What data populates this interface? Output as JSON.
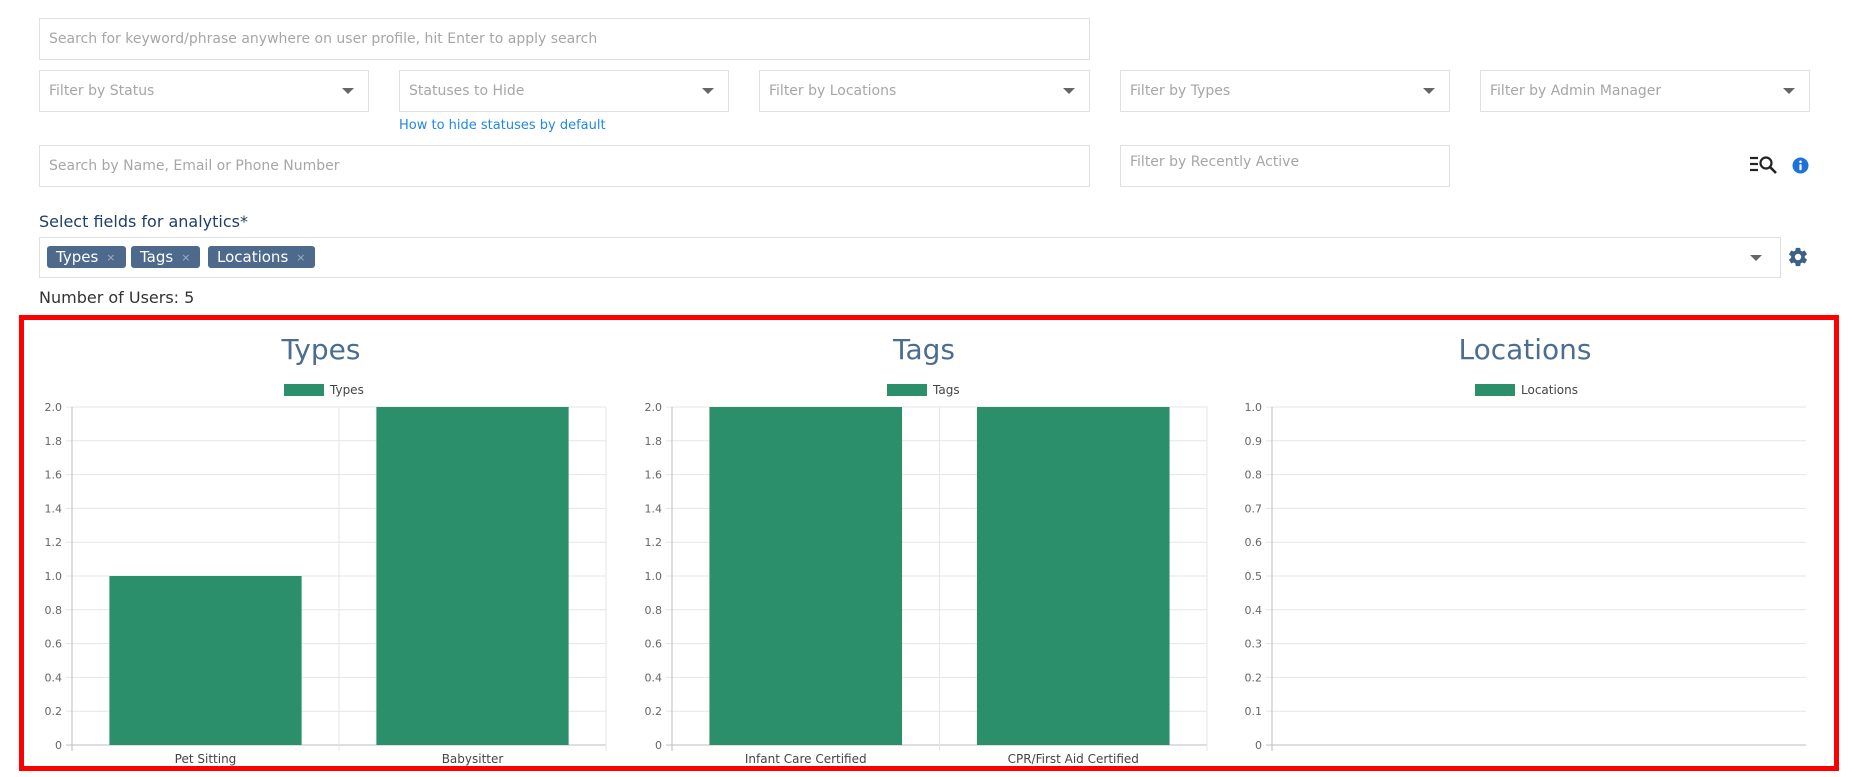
{
  "filters": {
    "keyword_search_placeholder": "Search for keyword/phrase anywhere on user profile, hit Enter to apply search",
    "status_placeholder": "Filter by Status",
    "statuses_hide_placeholder": "Statuses to Hide",
    "locations_placeholder": "Filter by Locations",
    "types_placeholder": "Filter by Types",
    "admin_manager_placeholder": "Filter by Admin Manager",
    "hide_statuses_link": "How to hide statuses by default",
    "name_search_placeholder": "Search by Name, Email or Phone Number",
    "recently_active_placeholder": "Filter by Recently Active",
    "icons": {
      "advanced_search": "list-search-icon",
      "info": "info-icon"
    }
  },
  "analytics": {
    "label": "Select fields for analytics*",
    "selected_tags": [
      "Types",
      "Tags",
      "Locations"
    ],
    "remove_symbol": "×",
    "settings_icon": "gear-icon",
    "user_count_text": "Number of Users: 5"
  },
  "colors": {
    "bar": "#2a8f6a",
    "title": "#4b6d92",
    "highlight_border": "#ff0000"
  },
  "chart_data": [
    {
      "type": "bar",
      "title": "Types",
      "legend": "Types",
      "categories": [
        "Pet Sitting",
        "Babysitter"
      ],
      "values": [
        1,
        2
      ],
      "ylim": [
        0,
        2
      ],
      "yticks": [
        "0",
        "0.2",
        "0.4",
        "0.6",
        "0.8",
        "1.0",
        "1.2",
        "1.4",
        "1.6",
        "1.8",
        "2.0"
      ],
      "grid": true
    },
    {
      "type": "bar",
      "title": "Tags",
      "legend": "Tags",
      "categories": [
        "Infant Care Certified",
        "CPR/First Aid Certified"
      ],
      "values": [
        2,
        2
      ],
      "ylim": [
        0,
        2
      ],
      "yticks": [
        "0",
        "0.2",
        "0.4",
        "0.6",
        "0.8",
        "1.0",
        "1.2",
        "1.4",
        "1.6",
        "1.8",
        "2.0"
      ],
      "grid": true
    },
    {
      "type": "bar",
      "title": "Locations",
      "legend": "Locations",
      "categories": [],
      "values": [],
      "ylim": [
        0,
        1
      ],
      "yticks": [
        "0",
        "0.1",
        "0.2",
        "0.3",
        "0.4",
        "0.5",
        "0.6",
        "0.7",
        "0.8",
        "0.9",
        "1.0"
      ],
      "grid": true
    }
  ]
}
